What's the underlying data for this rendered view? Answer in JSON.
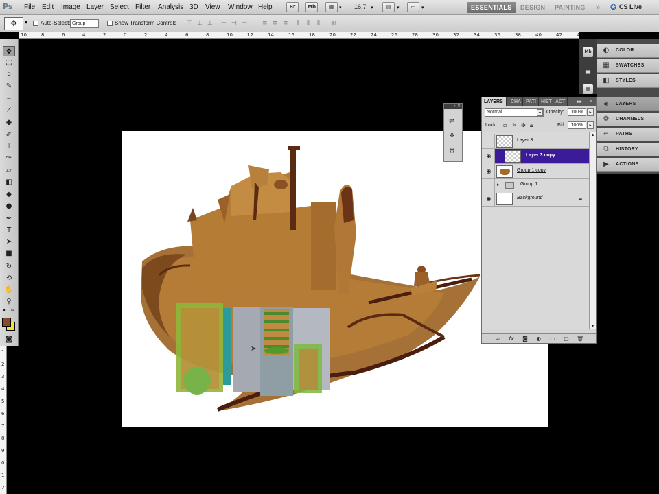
{
  "app": {
    "logo": "Ps"
  },
  "menu": [
    "File",
    "Edit",
    "Image",
    "Layer",
    "Select",
    "Filter",
    "Analysis",
    "3D",
    "View",
    "Window",
    "Help"
  ],
  "appbar": {
    "bridge_label": "Br",
    "minibridge_label": "Mb",
    "zoom_value": "16.7",
    "workspaces": [
      "ESSENTIALS",
      "DESIGN",
      "PAINTING"
    ],
    "more_label": "»",
    "cs_live_label": "CS Live"
  },
  "options": {
    "auto_select_label": "Auto-Select:",
    "auto_select_value": "Group",
    "transform_label": "Show Transform Controls"
  },
  "ruler": {
    "top_labels": [
      "10",
      "8",
      "6",
      "4",
      "2",
      "0",
      "2",
      "4",
      "6",
      "8",
      "10",
      "12",
      "14",
      "16",
      "18",
      "20",
      "22",
      "24",
      "26",
      "28",
      "30",
      "32",
      "34",
      "36",
      "38",
      "40",
      "42",
      "44"
    ],
    "left_labels": [
      "1",
      "2",
      "3",
      "4",
      "5",
      "6",
      "7",
      "8",
      "9",
      "0",
      "1",
      "2"
    ]
  },
  "tools": [
    "move",
    "marquee",
    "lasso",
    "quick-select",
    "crop",
    "eyedropper",
    "healing",
    "brush",
    "stamp",
    "history-brush",
    "eraser",
    "gradient",
    "blur",
    "dodge",
    "pen",
    "type",
    "path-select",
    "shape",
    "3d-rotate",
    "3d-orbit",
    "hand",
    "zoom"
  ],
  "colors": {
    "foreground": "#8a4a2a",
    "background": "#f3e33a",
    "selection": "#3b1b97"
  },
  "side_panels": [
    {
      "label": "COLOR",
      "icon": "color-icon"
    },
    {
      "label": "SWATCHES",
      "icon": "swatches-icon"
    },
    {
      "label": "STYLES",
      "icon": "styles-icon"
    },
    {
      "label": "LAYERS",
      "icon": "layers-icon"
    },
    {
      "label": "CHANNELS",
      "icon": "channels-icon"
    },
    {
      "label": "PATHS",
      "icon": "paths-icon"
    },
    {
      "label": "HISTORY",
      "icon": "history-icon"
    },
    {
      "label": "ACTIONS",
      "icon": "actions-icon"
    }
  ],
  "layers_panel": {
    "tabs": [
      "LAYERS",
      "CHA",
      "PATI",
      "HIST",
      "ACT"
    ],
    "blend_mode": "Normal",
    "opacity_label": "Opacity:",
    "opacity_value": "100%",
    "lock_label": "Lock:",
    "fill_label": "Fill:",
    "fill_value": "100%",
    "layers": [
      {
        "name": "Layer 3",
        "visible": false,
        "selected": false
      },
      {
        "name": "Layer 3 copy",
        "visible": true,
        "selected": true
      },
      {
        "name": "Group 1 copy",
        "visible": true,
        "selected": false
      },
      {
        "name": "Group 1",
        "visible": false,
        "selected": false
      },
      {
        "name": "Background",
        "visible": true,
        "selected": false,
        "locked": true
      }
    ]
  }
}
